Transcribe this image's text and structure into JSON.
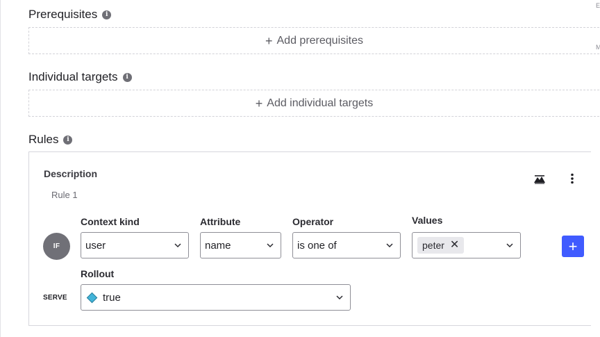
{
  "prerequisites": {
    "title": "Prerequisites",
    "info_icon": "info-icon",
    "add_label": "Add prerequisites"
  },
  "individual_targets": {
    "title": "Individual targets",
    "info_icon": "info-icon",
    "add_label": "Add individual targets"
  },
  "rules": {
    "title": "Rules",
    "info_icon": "info-icon",
    "rule": {
      "description_label": "Description",
      "rule_name": "Rule 1",
      "if_badge": "IF",
      "context_kind": {
        "label": "Context kind",
        "value": "user"
      },
      "attribute": {
        "label": "Attribute",
        "value": "name"
      },
      "operator": {
        "label": "Operator",
        "value": "is one of"
      },
      "values": {
        "label": "Values",
        "chips": [
          "peter"
        ]
      },
      "serve_label": "SERVE",
      "rollout": {
        "label": "Rollout",
        "value": "true",
        "variation_color": "#42b4d9"
      },
      "icons": [
        "mountain-icon",
        "kebab-menu-icon",
        "add-clause-icon"
      ]
    }
  },
  "right_edge_letters": [
    "E",
    "M"
  ],
  "colors": {
    "primary_button": "#405bff",
    "if_badge": "#707077",
    "chip_bg": "#e8e8ec"
  }
}
